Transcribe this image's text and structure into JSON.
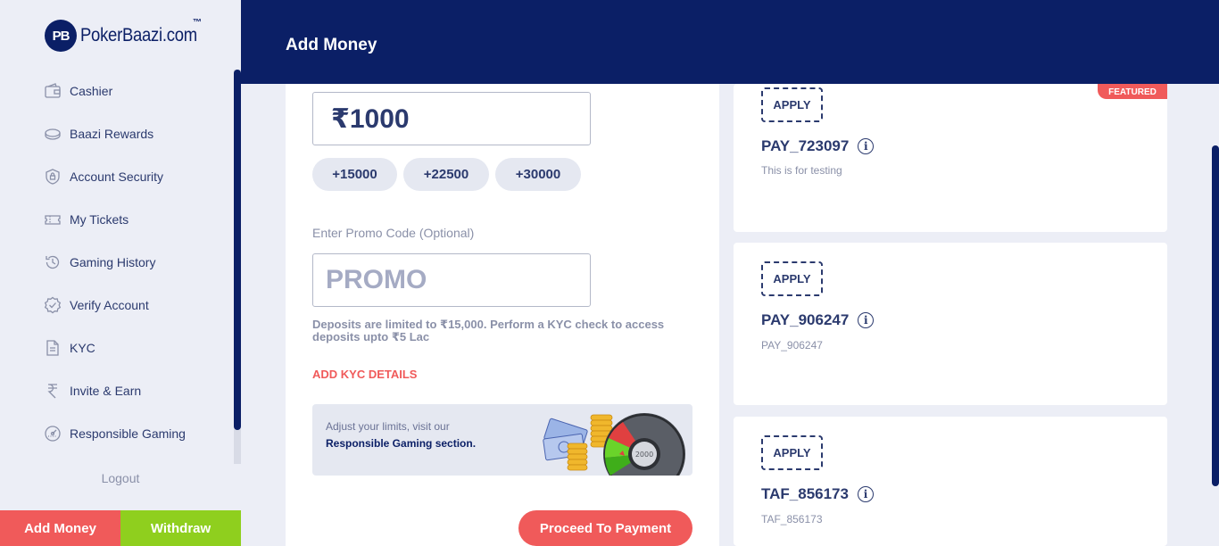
{
  "brand": {
    "logo_mark": "PB",
    "name": "PokerBaazi.com",
    "tm": "™"
  },
  "sidebar": {
    "items": [
      {
        "label": "Cashier",
        "icon": "wallet-icon"
      },
      {
        "label": "Baazi Rewards",
        "icon": "coin-icon"
      },
      {
        "label": "Account Security",
        "icon": "shield-icon"
      },
      {
        "label": "My Tickets",
        "icon": "ticket-icon"
      },
      {
        "label": "Gaming History",
        "icon": "history-icon"
      },
      {
        "label": "Verify Account",
        "icon": "verified-badge-icon"
      },
      {
        "label": "KYC",
        "icon": "document-icon"
      },
      {
        "label": "Invite & Earn",
        "icon": "rupee-icon"
      },
      {
        "label": "Responsible Gaming",
        "icon": "gauge-icon"
      }
    ],
    "logout": "Logout",
    "add_money": "Add Money",
    "withdraw": "Withdraw"
  },
  "header": {
    "title": "Add Money"
  },
  "form": {
    "amount": "₹1000",
    "quick_amounts": [
      "+15000",
      "+22500",
      "+30000"
    ],
    "promo_label": "Enter Promo Code (Optional)",
    "promo_placeholder": "PROMO",
    "limit_text": "Deposits are limited to ₹15,000. Perform a KYC check to access deposits upto ₹5 Lac",
    "kyc_link": "ADD KYC DETAILS",
    "banner_line1": "Adjust your limits, visit our",
    "banner_line2": "Responsible Gaming section.",
    "banner_dial_value": "2000",
    "proceed": "Proceed To Payment"
  },
  "offers": [
    {
      "apply": "APPLY",
      "code": "PAY_723097",
      "desc": "This is for testing",
      "badge": "FEATURED"
    },
    {
      "apply": "APPLY",
      "code": "PAY_906247",
      "desc": "PAY_906247"
    },
    {
      "apply": "APPLY",
      "code": "TAF_856173",
      "desc": "TAF_856173"
    }
  ],
  "colors": {
    "navy": "#0b1f66",
    "accent_red": "#f05a5a",
    "accent_green": "#8fcf1e",
    "text_primary": "#2b3a6e",
    "text_muted": "#8a90a8"
  }
}
